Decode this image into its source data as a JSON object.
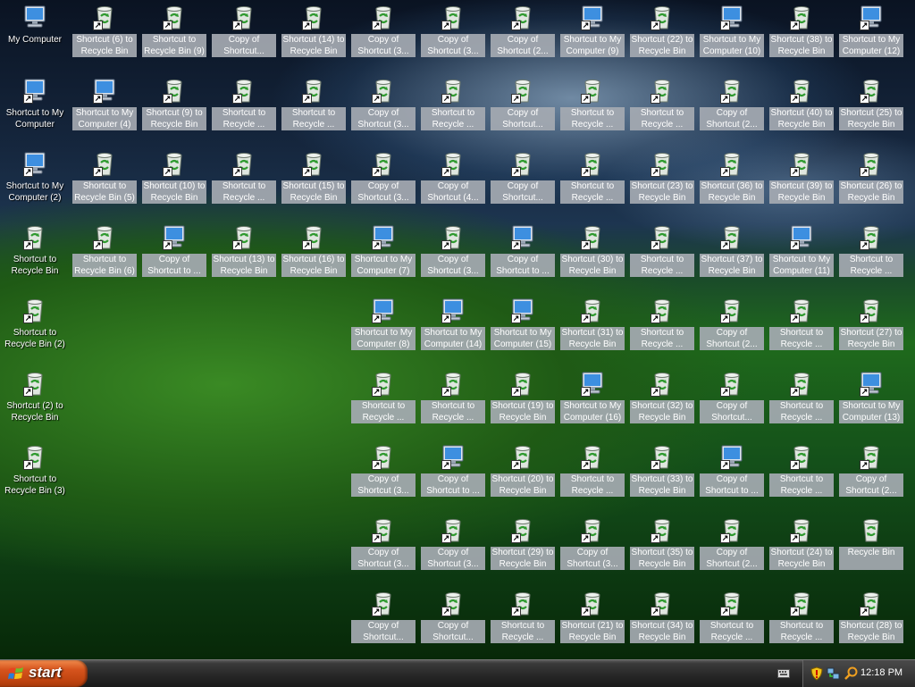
{
  "taskbar": {
    "start_label": "start",
    "clock": "12:18 PM"
  },
  "columns": [
    [
      "My Computer",
      "Shortcut to My Computer",
      "Shortcut to My Computer (2)",
      "Shortcut to Recycle Bin",
      "Shortcut to Recycle Bin (2)",
      "Shortcut (2) to Recycle Bin",
      "Shortcut to Recycle Bin (3)"
    ],
    [
      "Shortcut (6) to Recycle Bin",
      "Shortcut to My Computer (4)",
      "Shortcut to Recycle Bin (5)",
      "Shortcut to Recycle Bin (6)"
    ],
    [
      "Shortcut to Recycle Bin (9)",
      "Shortcut (9) to Recycle Bin",
      "Shortcut (10) to Recycle Bin",
      "Copy of Shortcut to ..."
    ],
    [
      "Copy of Shortcut...",
      "Shortcut to Recycle ...",
      "Shortcut to Recycle ...",
      "Shortcut (13) to Recycle Bin"
    ],
    [
      "Shortcut (14) to Recycle Bin",
      "Shortcut to Recycle ...",
      "Shortcut (15) to Recycle Bin",
      "Shortcut (16) to Recycle Bin"
    ],
    [
      "Copy of Shortcut (3...",
      "Copy of Shortcut (3...",
      "Copy of Shortcut (3...",
      "Shortcut to My Computer (7)",
      "Shortcut to My Computer (8)",
      "Shortcut to Recycle ...",
      "Copy of Shortcut (3...",
      "Copy of Shortcut (3...",
      "Copy of Shortcut..."
    ],
    [
      "Copy of Shortcut (3...",
      "Shortcut to Recycle ...",
      "Copy of Shortcut (4...",
      "Copy of Shortcut (3...",
      "Shortcut to My Computer (14)",
      "Shortcut to Recycle ...",
      "Copy of Shortcut to ...",
      "Copy of Shortcut (3...",
      "Copy of Shortcut..."
    ],
    [
      "Copy of Shortcut (2...",
      "Copy of Shortcut...",
      "Copy of Shortcut...",
      "Copy of Shortcut to ...",
      "Shortcut to My Computer (15)",
      "Shortcut (19) to Recycle Bin",
      "Shortcut (20) to Recycle Bin",
      "Shortcut (29) to Recycle Bin",
      "Shortcut to Recycle ..."
    ],
    [
      "Shortcut to My Computer (9)",
      "Shortcut to Recycle ...",
      "Shortcut to Recycle ...",
      "Shortcut (30) to Recycle Bin",
      "Shortcut (31) to Recycle Bin",
      "Shortcut to My Computer (16)",
      "Shortcut to Recycle ...",
      "Copy of Shortcut (3...",
      "Shortcut (21) to Recycle Bin"
    ],
    [
      "Shortcut (22) to Recycle Bin",
      "Shortcut to Recycle ...",
      "Shortcut (23) to Recycle Bin",
      "Shortcut to Recycle ...",
      "Shortcut to Recycle ...",
      "Shortcut (32) to Recycle Bin",
      "Shortcut (33) to Recycle Bin",
      "Shortcut (35) to Recycle Bin",
      "Shortcut (34) to Recycle Bin"
    ],
    [
      "Shortcut to My Computer (10)",
      "Copy of Shortcut (2...",
      "Shortcut (36) to Recycle Bin",
      "Shortcut (37) to Recycle Bin",
      "Copy of Shortcut (2...",
      "Copy of Shortcut...",
      "Copy of Shortcut to ...",
      "Copy of Shortcut (2...",
      "Shortcut to Recycle ..."
    ],
    [
      "Shortcut (38) to Recycle Bin",
      "Shortcut (40) to Recycle Bin",
      "Shortcut (39) to Recycle Bin",
      "Shortcut to My Computer (11)",
      "Shortcut to Recycle ...",
      "Shortcut to Recycle ...",
      "Shortcut to Recycle ...",
      "Shortcut (24) to Recycle Bin",
      "Shortcut to Recycle ..."
    ],
    [
      "Shortcut to My Computer (12)",
      "Shortcut (25) to Recycle Bin",
      "Shortcut (26) to Recycle Bin",
      "Shortcut to Recycle ...",
      "Shortcut (27) to Recycle Bin",
      "Shortcut to My Computer (13)",
      "Copy of Shortcut (2...",
      "Recycle Bin",
      "Shortcut (28) to Recycle Bin"
    ]
  ],
  "icon_types": {
    "computer": [
      "My Computer",
      "Shortcut to My Computer",
      "Shortcut to My Computer (2)",
      "Shortcut to My Computer (4)",
      "Shortcut to My Computer (7)",
      "Shortcut to My Computer (8)",
      "Shortcut to My Computer (9)",
      "Shortcut to My Computer (10)",
      "Shortcut to My Computer (11)",
      "Shortcut to My Computer (12)",
      "Shortcut to My Computer (13)",
      "Shortcut to My Computer (14)",
      "Shortcut to My Computer (15)",
      "Shortcut to My Computer (16)",
      "Copy of Shortcut to ..."
    ]
  }
}
